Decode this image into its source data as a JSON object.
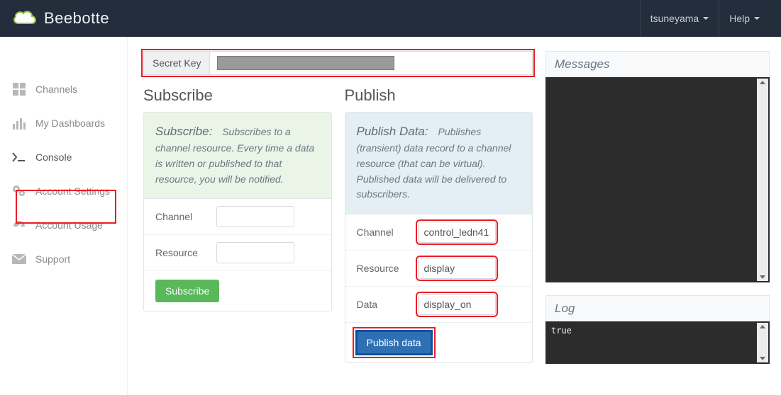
{
  "topbar": {
    "brand": "Beebotte",
    "user": "tsuneyama",
    "help": "Help"
  },
  "sidebar": {
    "items": [
      {
        "label": "Channels"
      },
      {
        "label": "My Dashboards"
      },
      {
        "label": "Console"
      },
      {
        "label": "Account Settings"
      },
      {
        "label": "Account Usage"
      },
      {
        "label": "Support"
      }
    ]
  },
  "secret": {
    "label": "Secret Key"
  },
  "subscribe": {
    "title": "Subscribe",
    "lead": "Subscribe:",
    "desc": "Subscribes to a channel resource. Every time a data is written or published to that resource, you will be notified.",
    "channel_label": "Channel",
    "resource_label": "Resource",
    "channel_value": "",
    "resource_value": "",
    "button": "Subscribe"
  },
  "publish": {
    "title": "Publish",
    "lead": "Publish Data:",
    "desc": "Publishes (transient) data record to a channel resource (that can be virtual). Published data will be delivered to subscribers.",
    "channel_label": "Channel",
    "resource_label": "Resource",
    "data_label": "Data",
    "channel_value": "control_ledn41",
    "resource_value": "display",
    "data_value": "display_on",
    "button": "Publish data"
  },
  "messages": {
    "title": "Messages"
  },
  "log": {
    "title": "Log",
    "line1": "true"
  }
}
